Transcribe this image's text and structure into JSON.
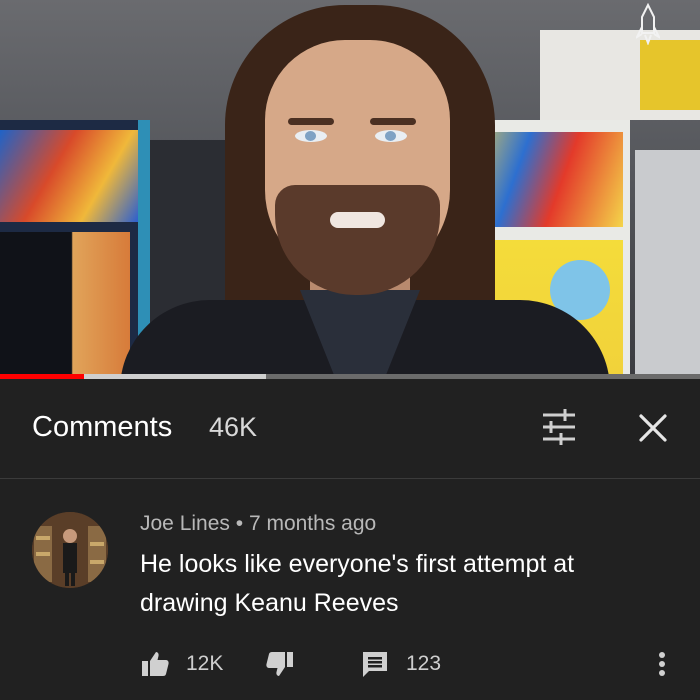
{
  "header": {
    "title": "Comments",
    "count": "46K"
  },
  "video": {
    "progress_fraction": 0.12,
    "buffered_fraction": 0.38
  },
  "comment": {
    "author": "Joe Lines",
    "separator": " • ",
    "time": "7 months ago",
    "text": "He looks like everyone's first attempt at drawing Keanu Reeves",
    "likes": "12K",
    "replies": "123"
  },
  "icons": {
    "sort": "sort-filter-icon",
    "close": "close-icon",
    "like": "thumbs-up-icon",
    "dislike": "thumbs-down-icon",
    "reply": "reply-comment-icon",
    "more": "more-vertical-icon",
    "watermark": "rocket-icon"
  },
  "colors": {
    "background": "#212121",
    "progress": "#ff0000",
    "text": "#ffffff",
    "meta": "#b8b8b8"
  }
}
